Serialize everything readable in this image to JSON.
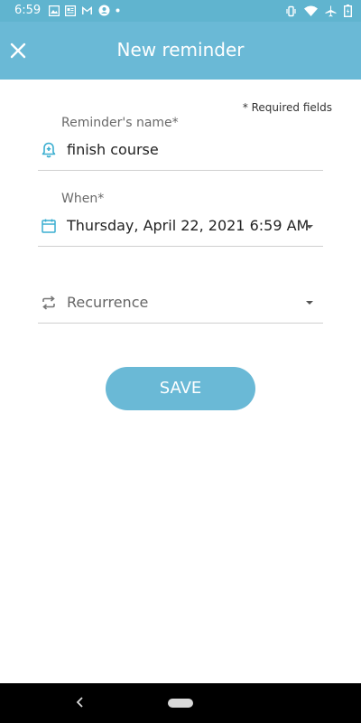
{
  "status_bar": {
    "time": "6:59",
    "icons": [
      "image-icon",
      "news-icon",
      "gmail-icon",
      "account-icon",
      "dot-icon",
      "vibrate-icon",
      "wifi-icon",
      "airplane-icon",
      "battery-icon"
    ]
  },
  "app_bar": {
    "title": "New reminder",
    "close_icon": "close-icon"
  },
  "form": {
    "required_note": "* Required fields",
    "name_label": "Reminder's name*",
    "name_value": "finish course",
    "name_icon": "bell-plus-icon",
    "when_label": "When*",
    "when_value": "Thursday, April 22, 2021 6:59 AM",
    "when_icon": "calendar-icon",
    "recurrence_value": "Recurrence",
    "recurrence_icon": "repeat-icon"
  },
  "actions": {
    "save_label": "SAVE"
  },
  "colors": {
    "status_bar": "#60b4cf",
    "app_bar": "#6ab9d6",
    "accent_icon": "#3aaed0",
    "nav_bar": "#000000"
  }
}
